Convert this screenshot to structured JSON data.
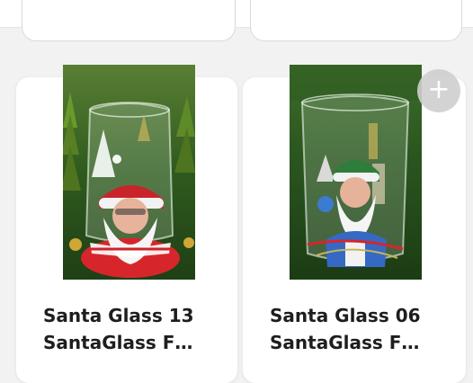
{
  "products": [
    {
      "name": "Santa Glass 13",
      "subtitle": "SantaGlass F…"
    },
    {
      "name": "Santa Glass 06",
      "subtitle": "SantaGlass F…"
    }
  ],
  "add_button": {
    "label": "+"
  },
  "colors": {
    "logo": "#1a7be0",
    "card": "#ffffff",
    "background": "#f2f2f2"
  }
}
